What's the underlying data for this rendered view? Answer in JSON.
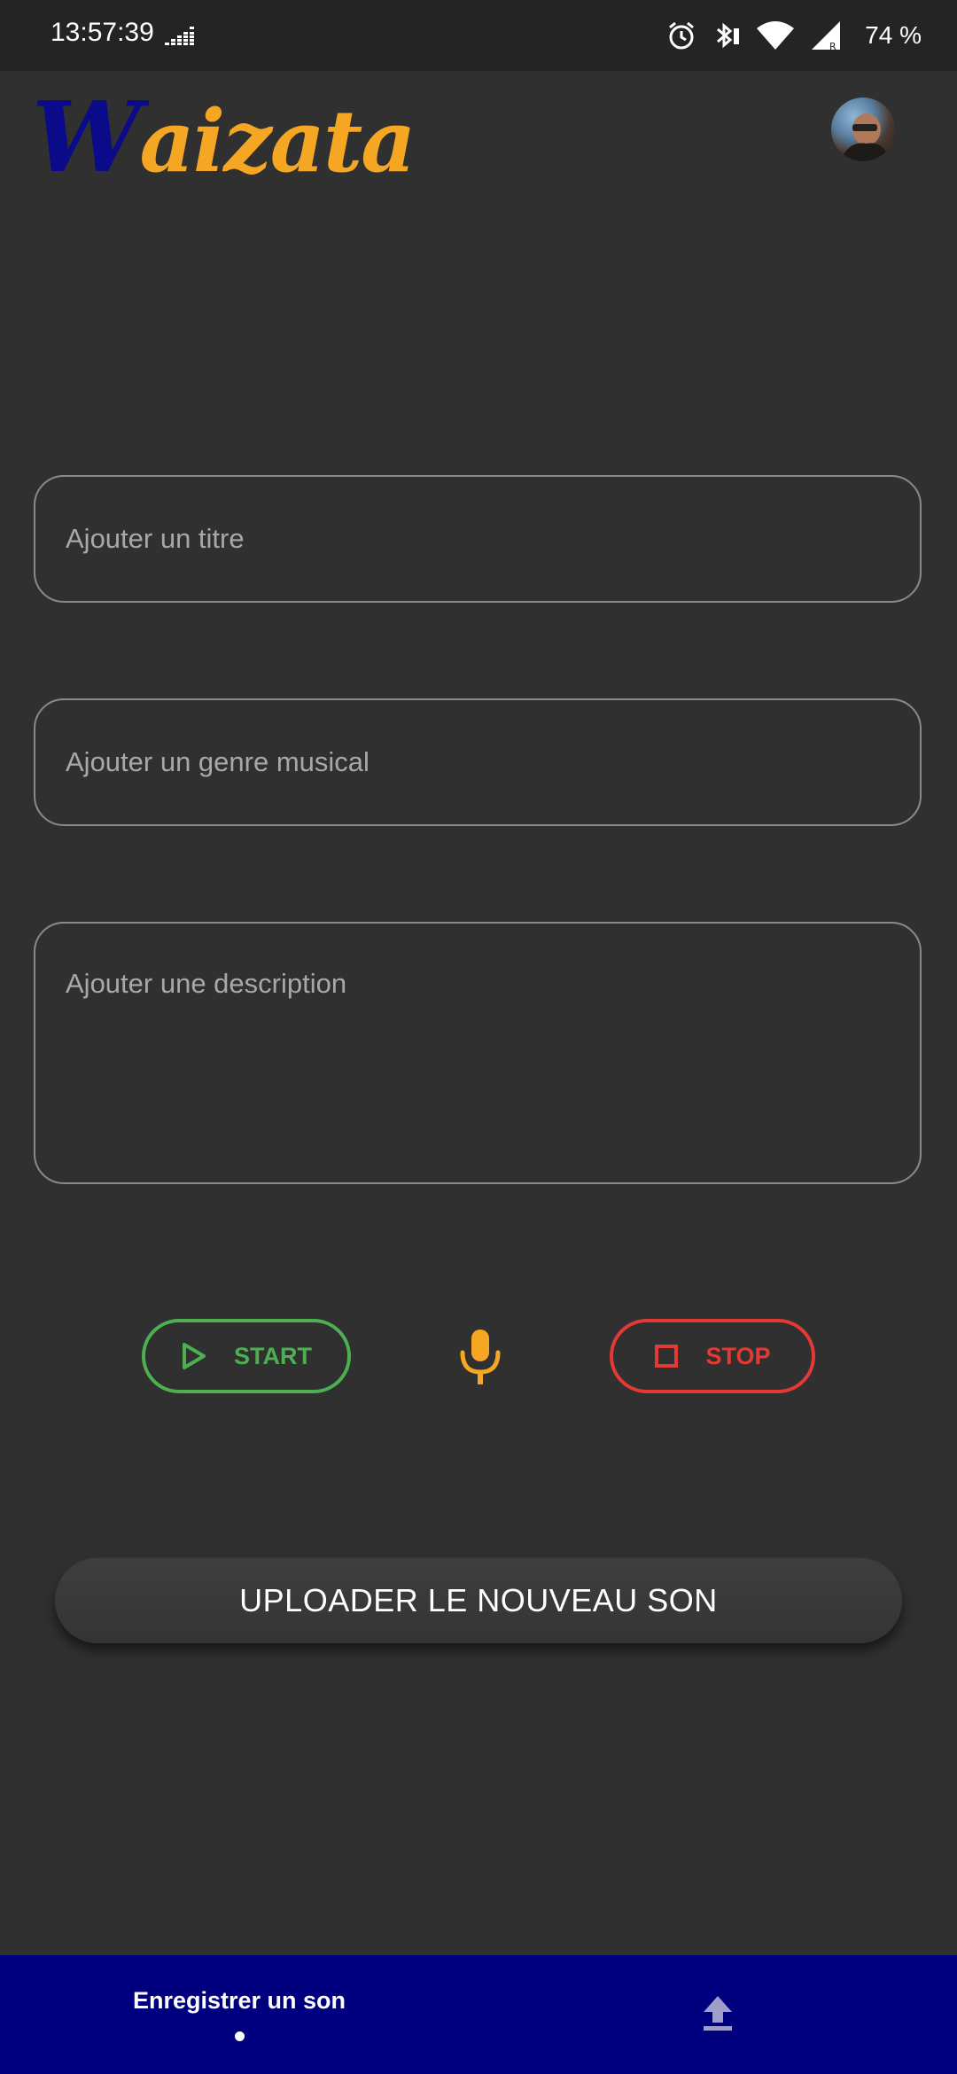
{
  "status_bar": {
    "time": "13:57:39",
    "battery": "74 %",
    "icons": [
      "equalizer-icon",
      "alarm-icon",
      "bluetooth-icon",
      "wifi-icon",
      "signal-icon"
    ]
  },
  "header": {
    "logo_first": "W",
    "logo_rest": "aizata",
    "avatar": "user-avatar"
  },
  "form": {
    "title_placeholder": "Ajouter un titre",
    "genre_placeholder": "Ajouter un genre musical",
    "description_placeholder": "Ajouter une description"
  },
  "controls": {
    "start_label": "START",
    "stop_label": "STOP",
    "start_color": "#4caf50",
    "stop_color": "#e53935",
    "mic_color": "#f5a623"
  },
  "upload_button": {
    "label": "UPLOADER LE NOUVEAU SON"
  },
  "bottom_nav": {
    "items": [
      {
        "label": "Enregistrer un son",
        "icon": "record-dot-icon",
        "active": true
      },
      {
        "label": "",
        "icon": "upload-icon",
        "active": false
      }
    ],
    "background": "#00007e"
  }
}
